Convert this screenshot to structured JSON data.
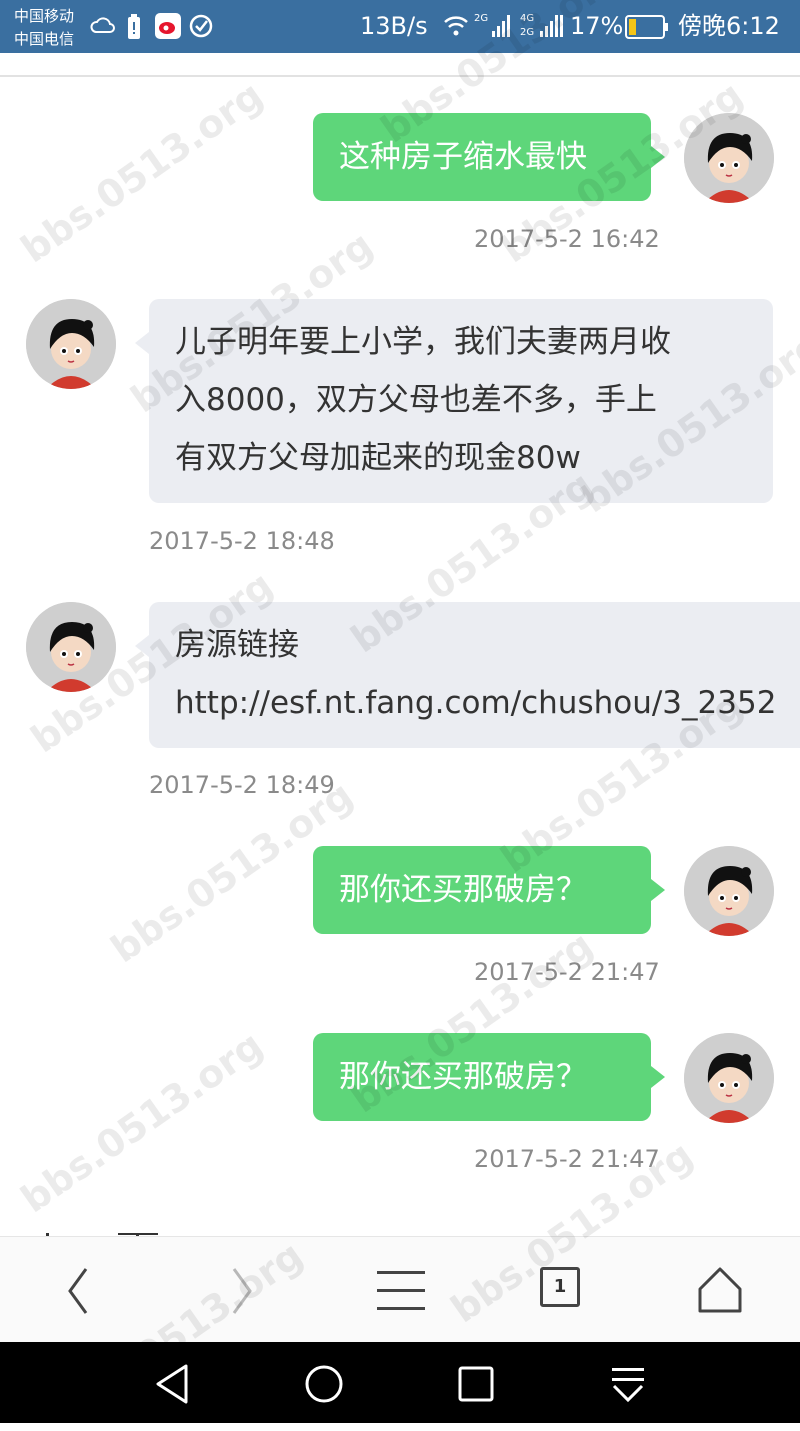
{
  "status_bar": {
    "carrier_1": "中国移动",
    "carrier_2": "中国电信",
    "speed": "13B/s",
    "network_a": "2G",
    "network_b": "4G 2G",
    "battery": "17%",
    "time": "傍晚6:12"
  },
  "messages": [
    {
      "side": "right",
      "text": "这种房子缩水最快",
      "time": "2017-5-2 16:42"
    },
    {
      "side": "left",
      "lines": [
        "儿子明年要上小学，我们夫妻两月收",
        "入8000，双方父母也差不多，手上",
        "有双方父母加起来的现金80w"
      ],
      "time": "2017-5-2 18:48"
    },
    {
      "side": "left",
      "lines": [
        "房源链接",
        "http://esf.nt.fang.com/chushou/3_2352"
      ],
      "time": "2017-5-2 18:49"
    },
    {
      "side": "right",
      "text": "那你还买那破房？",
      "time": "2017-5-2 21:47"
    },
    {
      "side": "right",
      "text": "那你还买那破房？",
      "time": "2017-5-2 21:47"
    }
  ],
  "toolbar": {
    "tab_count": "1"
  },
  "watermark": "bbs.0513.org",
  "colors": {
    "status_bar": "#3a6fa0",
    "sent_bubble": "#5ed67a",
    "received_bubble": "#ebedf2"
  },
  "icons": [
    "back-icon",
    "forward-icon",
    "menu-icon",
    "tabs-icon",
    "home-icon",
    "nav-back-icon",
    "nav-home-icon",
    "nav-recents-icon",
    "nav-notification-icon"
  ]
}
